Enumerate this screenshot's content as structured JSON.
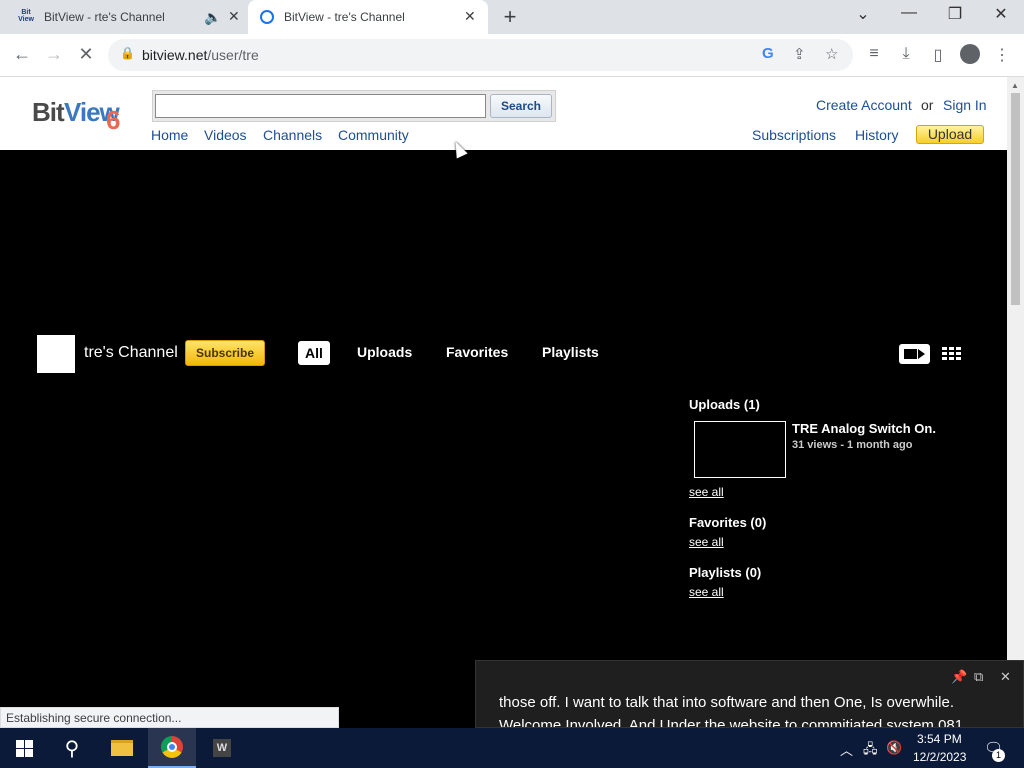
{
  "browser": {
    "tabs": [
      {
        "title": "BitView - rte's Channel",
        "favicon": "Bit View"
      },
      {
        "title": "BitView - tre's Channel"
      }
    ],
    "new_tab": "+",
    "url_host": "bitview.net",
    "url_path": "/user/tre",
    "status": "Establishing secure connection..."
  },
  "site": {
    "logo": {
      "bit": "Bit",
      "view": "View",
      "six": "6"
    },
    "search_placeholder": "",
    "search_button": "Search",
    "nav": [
      "Home",
      "Videos",
      "Channels",
      "Community"
    ],
    "create_account": "Create Account",
    "or": "or",
    "sign_in": "Sign In",
    "subscriptions": "Subscriptions",
    "history": "History",
    "upload": "Upload"
  },
  "channel": {
    "name": "tre's Channel",
    "subscribe": "Subscribe",
    "tabs": [
      "All",
      "Uploads",
      "Favorites",
      "Playlists"
    ],
    "uploads_heading": "Uploads (1)",
    "video_title": "TRE Analog Switch On.",
    "video_meta": "31 views - 1 month ago",
    "see_all": "see all",
    "favorites_heading": "Favorites (0)",
    "playlists_heading": "Playlists (0)"
  },
  "caption": {
    "line1": "those off. I want to talk that into software and then One, Is overwhile.",
    "line2": "Welcome Involved. And Under the website to commitiated system 081"
  },
  "taskbar": {
    "time": "3:54 PM",
    "date": "12/2/2023",
    "notifications": "1",
    "word_label": "W"
  }
}
